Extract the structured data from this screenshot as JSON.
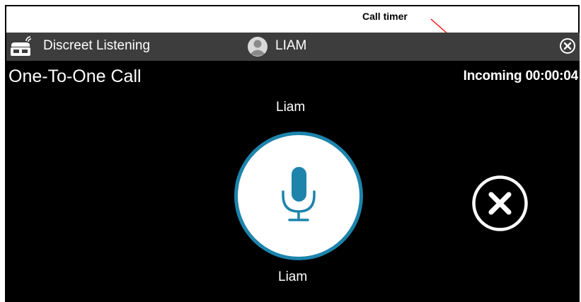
{
  "annotation": {
    "label": "Call timer",
    "color": "#ff0000"
  },
  "titlebar": {
    "app_title": "Discreet Listening",
    "user_name": "LIAM",
    "listen_icon": "discreet-listening-icon",
    "avatar_icon": "user-avatar-icon",
    "close_icon": "close-circle-icon"
  },
  "call": {
    "type": "One-To-One Call",
    "status": "Incoming 00:00:04",
    "participant_top": "Liam",
    "participant_bottom": "Liam",
    "mic_icon": "microphone-icon",
    "end_icon": "end-call-x-icon"
  },
  "colors": {
    "titlebar_bg": "#3d3d3d",
    "main_bg": "#000000",
    "accent": "#1d84ac",
    "text": "#ffffff"
  }
}
